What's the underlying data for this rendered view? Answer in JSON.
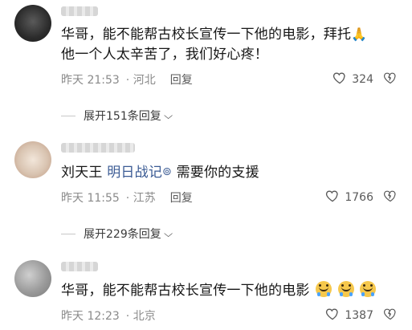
{
  "comments": [
    {
      "text_line1": "华哥，能不能帮古校长宣传一下他的电影，拜托",
      "text_line2": "他一个人太辛苦了，我们好心疼！",
      "time": "昨天 21:53",
      "location": "· 河北",
      "reply_label": "回复",
      "likes": "324",
      "expand_label": "展开151条回复"
    },
    {
      "text_prefix": "刘天王",
      "mention": "明日战记",
      "text_suffix": "需要你的支援",
      "time": "昨天 11:55",
      "location": "· 江苏",
      "reply_label": "回复",
      "likes": "1766",
      "expand_label": "展开229条回复"
    },
    {
      "text": "华哥，能不能帮古校长宣传一下他的电影",
      "time": "昨天 12:23",
      "location": "· 北京",
      "likes": "1387"
    }
  ],
  "icons": {
    "like": "heart-outline-icon",
    "dislike": "broken-heart-icon",
    "expand": "chevron-down-icon",
    "mention": "at-sign-icon",
    "emoji": "crying-face-emoji",
    "praying": "praying-hands-emoji"
  }
}
